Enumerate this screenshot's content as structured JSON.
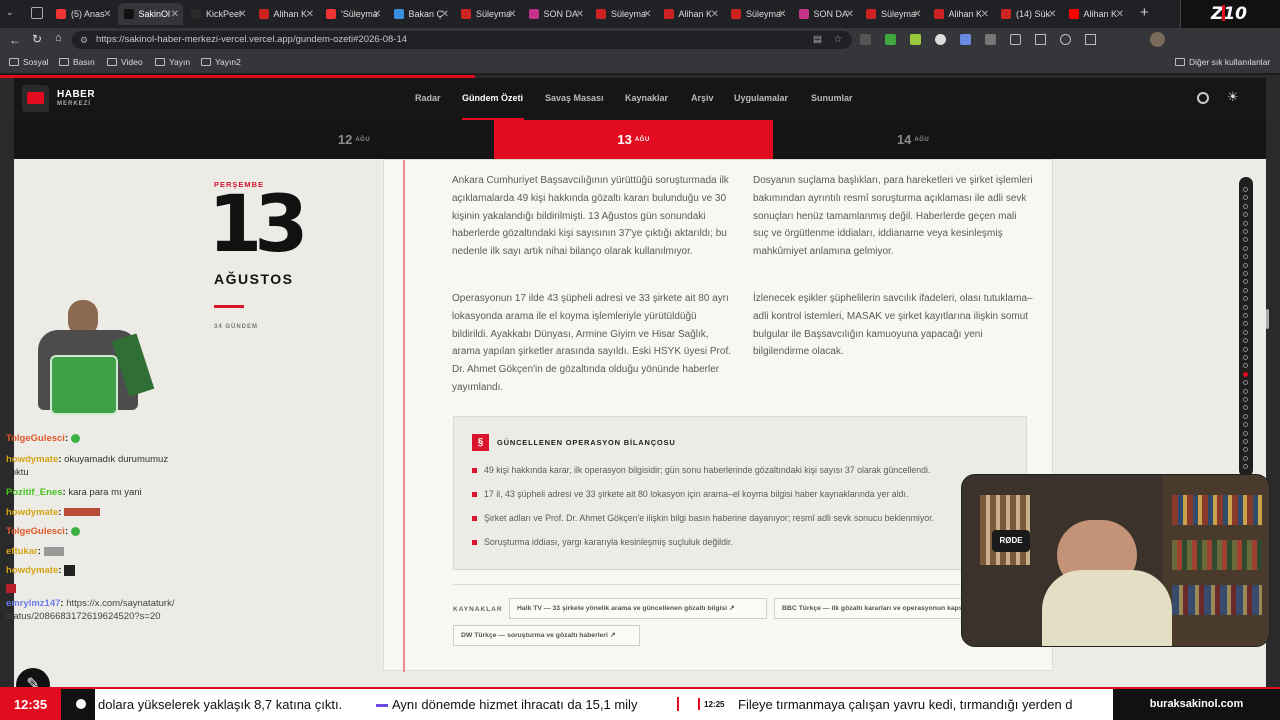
{
  "browser": {
    "tabs": [
      "(5) Anas",
      "SakinOl",
      "KickPeel",
      "Alihan K",
      "'Süleyma",
      "Bakan Ç",
      "Süleyma",
      "SON DA",
      "Süleyma",
      "Alihan K",
      "Süleyma",
      "SON DA",
      "Süleyma",
      "Alihan K",
      "(14) Sük",
      "Alihan K"
    ],
    "url": "https://sakinol-haber-merkezi-vercel.vercel.app/gundem-ozeti#2026-08-14",
    "bookmarks": [
      "Sosyal",
      "Basın",
      "Video",
      "Yayın",
      "Yayın2"
    ],
    "other_bookmarks": "Diğer sık kullanılanlar",
    "colors": {
      "accent": "#e30b20"
    }
  },
  "site": {
    "logo_line1": "HABER",
    "logo_line2": "MERKEZİ",
    "nav": [
      "Radar",
      "Gündem Özeti",
      "Savaş Masası",
      "Kaynaklar",
      "Arşiv",
      "Uygulamalar",
      "Sunumlar"
    ],
    "dates": [
      {
        "day": "12",
        "mon": "AĞU"
      },
      {
        "day": "13",
        "mon": "AĞU"
      },
      {
        "day": "14",
        "mon": "AĞU"
      }
    ]
  },
  "day_panel": {
    "weekday": "PERŞEMBE",
    "day": "13",
    "month": "AĞUSTOS",
    "count": "34 GÜNDEM"
  },
  "article": {
    "left_p1": "Ankara Cumhuriyet Başsavcılığının yürüttüğü soruşturmada ilk açıklamalarda 49 kişi hakkında gözaltı kararı bulunduğu ve 30 kişinin yakalandığı bildirilmişti. 13 Ağustos gün sonundaki haberlerde gözaltındaki kişi sayısının 37'ye çıktığı aktarıldı; bu nedenle ilk sayı artık nihai bilanço olarak kullanılmıyor.",
    "left_p2": "Operasyonun 17 ilde 43 şüpheli adresi ve 33 şirkete ait 80 ayrı lokasyonda arama ile el koyma işlemleriyle yürütüldüğü bildirildi. Ayakkabı Dünyası, Armine Giyim ve Hisar Sağlık, arama yapılan şirketler arasında sayıldı. Eski HSYK üyesi Prof. Dr. Ahmet Gökçen'in de gözaltında olduğu yönünde haberler yayımlandı.",
    "right_p1": "Dosyanın suçlama başlıkları, para hareketleri ve şirket işlemleri bakımından ayrıntılı resmî soruşturma açıklaması ile adli sevk sonuçları henüz tamamlanmış değil. Haberlerde geçen mali suç ve örgütlenme iddiaları, iddianame veya kesinleşmiş mahkûmiyet anlamına gelmiyor.",
    "right_p2": "İzlenecek eşikler şüphelilerin savcılık ifadeleri, olası tutuklama–adli kontrol istemleri, MASAK ve şirket kayıtlarına ilişkin somut bulgular ile Başsavcılığın kamuoyuna yapacağı yeni bilgilendirme olacak.",
    "box_icon": "§",
    "box_title": "GÜNCELLENEN OPERASYON BİLANÇOSU",
    "bullets": [
      "49 kişi hakkında karar, ilk operasyon bilgisidir; gün sonu haberlerinde gözaltındaki kişi sayısı 37 olarak güncellendi.",
      "17 il, 43 şüpheli adresi ve 33 şirkete ait 80 lokasyon için arama–el koyma bilgisi haber kaynaklarında yer aldı.",
      "Şirket adları ve Prof. Dr. Ahmet Gökçen'e ilişkin bilgi basın haberine dayanıyor; resmî adli sevk sonucu beklenmiyor.",
      "Soruşturma iddiası, yargı kararıyla kesinleşmiş suçluluk değildir."
    ],
    "sources_label": "KAYNAKLAR",
    "sources": [
      "Halk TV — 33 şirkete yönelik arama ve güncellenen gözaltı bilgisi ↗",
      "BBC Türkçe — ilk gözaltı kararları ve operasyonun kapsamı ↗",
      "DW Türkçe — soruşturma ve gözaltı haberleri ↗"
    ]
  },
  "chat": [
    {
      "user": "TolgeGulesci",
      "msg": "",
      "color": "#e05a2a"
    },
    {
      "user": "howdymate",
      "msg": "okuyamadık durumumuz yoktu",
      "color": "#d4a514"
    },
    {
      "user": "Pozitif_Enes",
      "msg": "kara para mı yani",
      "color": "#46c21e"
    },
    {
      "user": "howdymate",
      "msg": "",
      "color": "#d4a514"
    },
    {
      "user": "TolgeGulesci",
      "msg": "",
      "color": "#e05a2a"
    },
    {
      "user": "eftukar",
      "msg": "",
      "color": "#d4a514"
    },
    {
      "user": "howdymate",
      "msg": "",
      "color": "#d4a514"
    },
    {
      "user": "emrylmz147",
      "msg": "https://x.com/saynataturk/status/2086683172619624520?s=20",
      "color": "#6f7cf0"
    }
  ],
  "ticker": {
    "clock": "12:35",
    "item1": "dolara yükselerek yaklaşık 8,7 katına çıktı.",
    "item2": "Aynı dönemde hizmet ihracatı da 15,1 mily",
    "time2": "12:25",
    "item3": "Fileye tırmanmaya çalışan yavru kedi, tırmandığı yerden d",
    "brand": "buraksakinol.com"
  },
  "overlay": {
    "logo": "Z10",
    "mic_brand": "RØDE"
  }
}
